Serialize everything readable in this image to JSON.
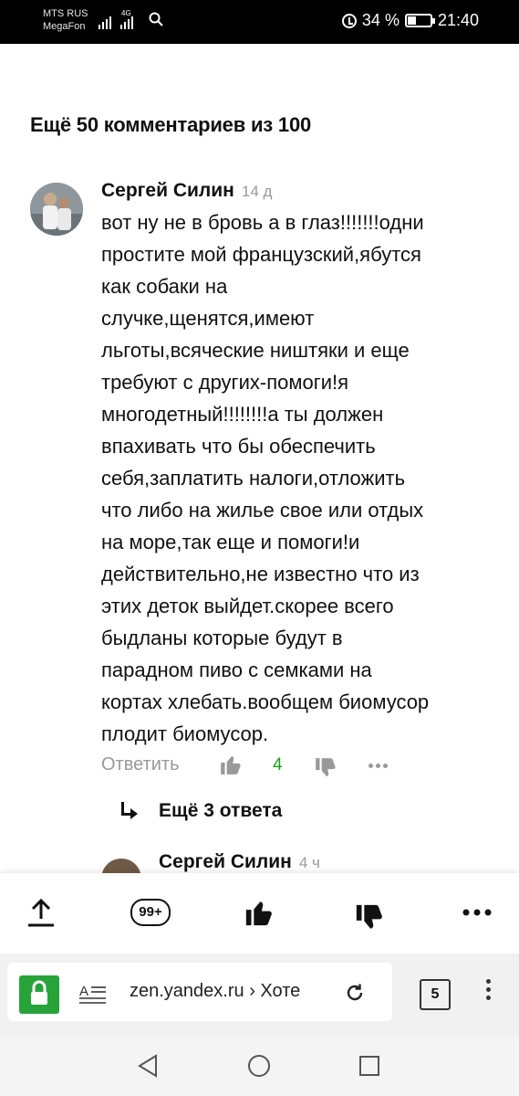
{
  "status_bar": {
    "carrier_1": "MTS RUS",
    "carrier_2": "MegaFon",
    "network": "4G",
    "battery": "34 %",
    "time": "21:40"
  },
  "comments_section": {
    "more_comments": "Ещё 50 комментариев из 100"
  },
  "comment": {
    "author": "Сергей Силин",
    "time": "14 д",
    "text": "вот ну не в бровь а в глаз!!!!!!!одни\nпростите мой французский,ябутся\nкак собаки на\nслучке,щенятся,имеют\nльготы,всяческие ништяки и еще\nтребуют с других-помоги!я\nмногодетный!!!!!!!!а ты должен\nвпахивать что бы обеспечить\nсебя,заплатить налоги,отложить\nчто либо на жилье свое или отдых\nна море,так еще и помоги!и\nдействительно,не известно что из\nэтих деток выйдет.скорее всего\nбыдланы которые будут в\nпарадном пиво с семками на\nкортах хлебать.вообщем биомусор\nплодит биомусор.",
    "reply_label": "Ответить",
    "likes": "4",
    "replies_label": "Ещё 3 ответа"
  },
  "next_comment": {
    "author": "Сергей Силин",
    "time": "4 ч"
  },
  "action_bar": {
    "comments_badge": "99+"
  },
  "browser": {
    "url": "zen.yandex.ru › Хоте",
    "tabs_count": "5"
  },
  "colors": {
    "like_green": "#15a315",
    "lock_green": "#27a33a",
    "muted": "#999999"
  }
}
